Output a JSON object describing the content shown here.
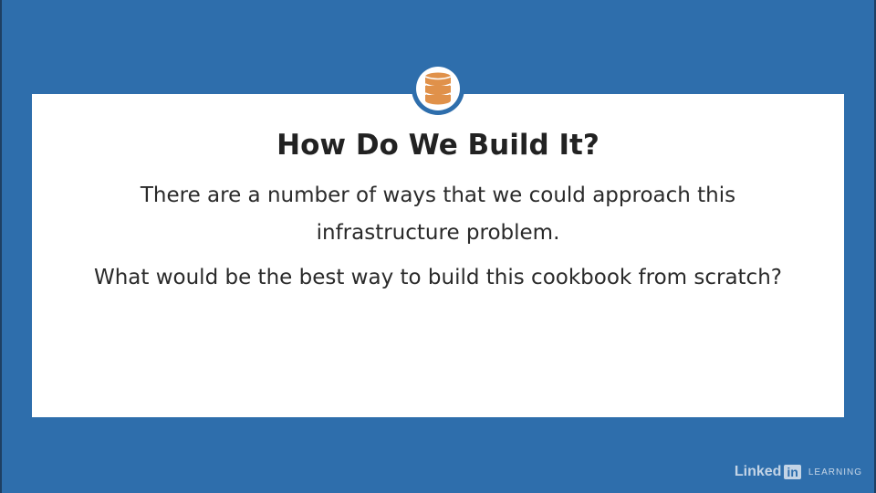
{
  "slide": {
    "title": "How Do We Build It?",
    "body_line_1": "There are a number of ways that we could approach this",
    "body_line_2": "infrastructure problem.",
    "body_line_3": "What would be the best way to build this cookbook from scratch?"
  },
  "badge": {
    "icon": "database-icon",
    "icon_color": "#e0914a",
    "ring_color": "#2e6eac"
  },
  "watermark": {
    "linked": "Linked",
    "in": "in",
    "learning": "LEARNING"
  },
  "colors": {
    "background": "#2e6eac",
    "card": "#ffffff",
    "title_text": "#222222",
    "body_text": "#2a2a2a"
  }
}
